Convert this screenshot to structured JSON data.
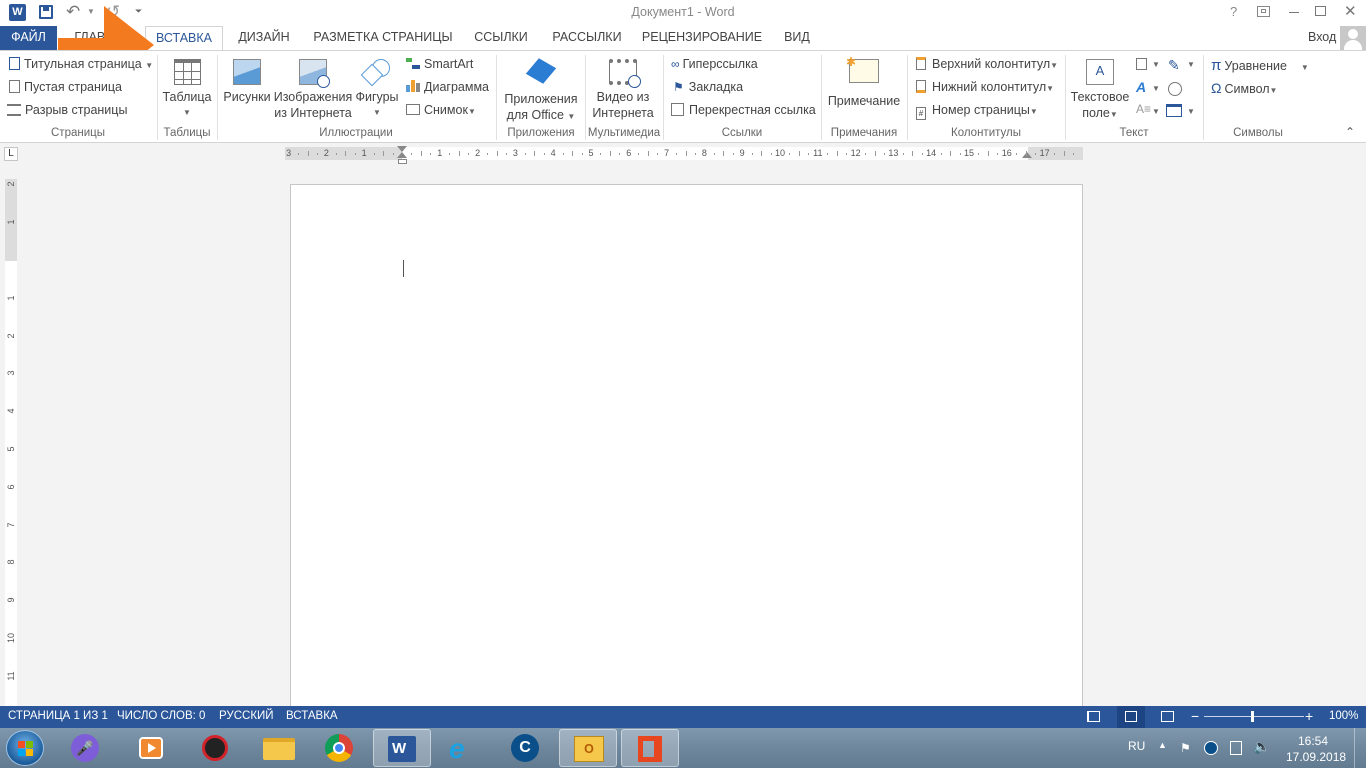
{
  "titlebar": {
    "title": "Документ1 - Word",
    "help": "?",
    "app_icon": "word-icon"
  },
  "tabs": {
    "file": "ФАЙЛ",
    "home": "ГЛАВНАЯ",
    "insert": "ВСТАВКА",
    "design": "ДИЗАЙН",
    "layout": "РАЗМЕТКА СТРАНИЦЫ",
    "references": "ССЫЛКИ",
    "mailings": "РАССЫЛКИ",
    "review": "РЕЦЕНЗИРОВАНИЕ",
    "view": "ВИД",
    "signin": "Вход"
  },
  "ribbon": {
    "pages": {
      "label": "Страницы",
      "cover": "Титульная страница",
      "blank": "Пустая страница",
      "break": "Разрыв страницы"
    },
    "tables": {
      "label": "Таблицы",
      "table": "Таблица"
    },
    "illustrations": {
      "label": "Иллюстрации",
      "pictures": "Рисунки",
      "online_l1": "Изображения",
      "online_l2": "из Интернета",
      "shapes": "Фигуры",
      "smartart": "SmartArt",
      "chart": "Диаграмма",
      "screenshot": "Снимок"
    },
    "apps": {
      "label": "Приложения",
      "l1": "Приложения",
      "l2": "для Office"
    },
    "media": {
      "label": "Мультимедиа",
      "l1": "Видео из",
      "l2": "Интернета"
    },
    "links": {
      "label": "Ссылки",
      "hyperlink": "Гиперссылка",
      "bookmark": "Закладка",
      "crossref": "Перекрестная ссылка"
    },
    "comments": {
      "label": "Примечания",
      "comment": "Примечание"
    },
    "headerfooter": {
      "label": "Колонтитулы",
      "header": "Верхний колонтитул",
      "footer": "Нижний колонтитул",
      "pagenum": "Номер страницы"
    },
    "text": {
      "label": "Текст",
      "textbox_l1": "Текстовое",
      "textbox_l2": "поле"
    },
    "symbols": {
      "label": "Символы",
      "equation": "Уравнение",
      "symbol": "Символ"
    }
  },
  "ruler": {
    "left_marks": [
      "3",
      "2",
      "1"
    ],
    "right_marks": [
      "1",
      "2",
      "3",
      "4",
      "5",
      "6",
      "7",
      "8",
      "9",
      "10",
      "11",
      "12",
      "13",
      "14",
      "15",
      "16",
      "17"
    ],
    "vertical_marks": [
      "2",
      "1",
      "1",
      "2",
      "3",
      "4",
      "5",
      "6",
      "7",
      "8",
      "9",
      "10",
      "11"
    ]
  },
  "statusbar": {
    "page": "СТРАНИЦА 1 ИЗ 1",
    "words": "ЧИСЛО СЛОВ: 0",
    "language": "РУССКИЙ",
    "mode": "ВСТАВКА",
    "zoom": "100%"
  },
  "taskbar": {
    "lang": "RU",
    "time": "16:54",
    "date": "17.09.2018"
  },
  "colors": {
    "accent": "#2b579a",
    "arrow": "#f47a20"
  }
}
